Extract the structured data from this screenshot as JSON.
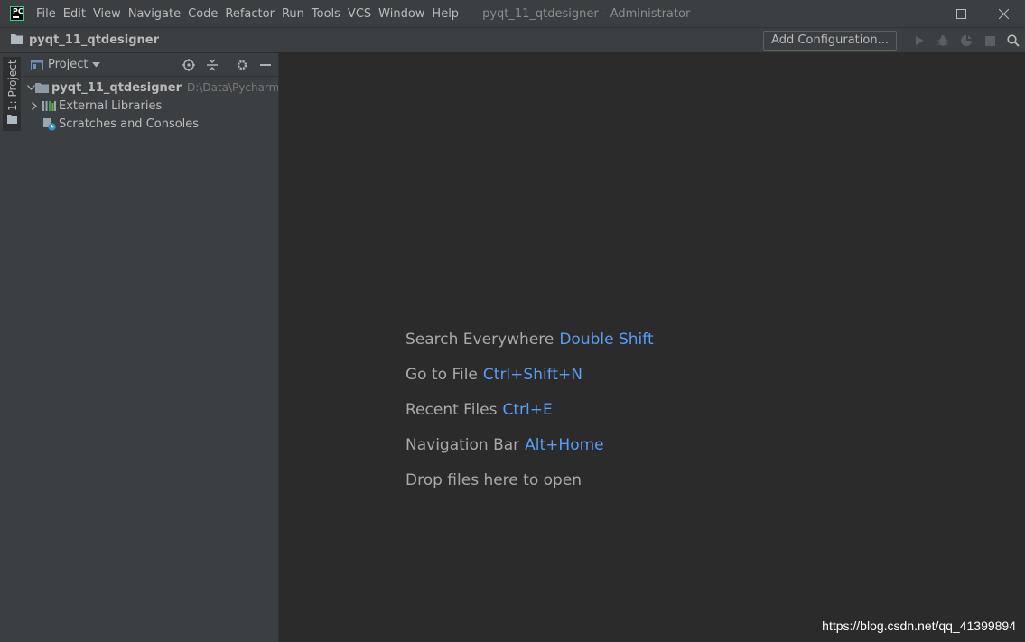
{
  "app": {
    "logo_text": "PC",
    "window_title": "pyqt_11_qtdesigner - Administrator"
  },
  "menu": [
    "File",
    "Edit",
    "View",
    "Navigate",
    "Code",
    "Refactor",
    "Run",
    "Tools",
    "VCS",
    "Window",
    "Help"
  ],
  "window_controls": [
    "minimize-icon",
    "maximize-icon",
    "close-icon"
  ],
  "navbar": {
    "project_name": "pyqt_11_qtdesigner",
    "add_configuration": "Add Configuration...",
    "tools": [
      "run-icon",
      "debug-icon",
      "coverage-icon",
      "stop-icon",
      "search-icon"
    ]
  },
  "tool_strip": {
    "project_tab": "1: Project"
  },
  "project_panel": {
    "title": "Project",
    "tree": [
      {
        "label": "pyqt_11_qtdesigner",
        "path": "D:\\Data\\PycharmPro",
        "expanded": true,
        "icon": "folder-icon"
      },
      {
        "label": "External Libraries",
        "expanded": false,
        "icon": "libraries-icon"
      },
      {
        "label": "Scratches and Consoles",
        "icon": "scratches-icon"
      }
    ]
  },
  "editor": {
    "hints": [
      {
        "label": "Search Everywhere",
        "key": "Double Shift"
      },
      {
        "label": "Go to File",
        "key": "Ctrl+Shift+N"
      },
      {
        "label": "Recent Files",
        "key": "Ctrl+E"
      },
      {
        "label": "Navigation Bar",
        "key": "Alt+Home"
      },
      {
        "label": "Drop files here to open",
        "key": ""
      }
    ]
  },
  "watermark": "https://blog.csdn.net/qq_41399894",
  "colors": {
    "panel_bg": "#3c3f41",
    "editor_bg": "#2b2b2b",
    "shortcut": "#589df6",
    "logo_accent": "#21d789"
  }
}
